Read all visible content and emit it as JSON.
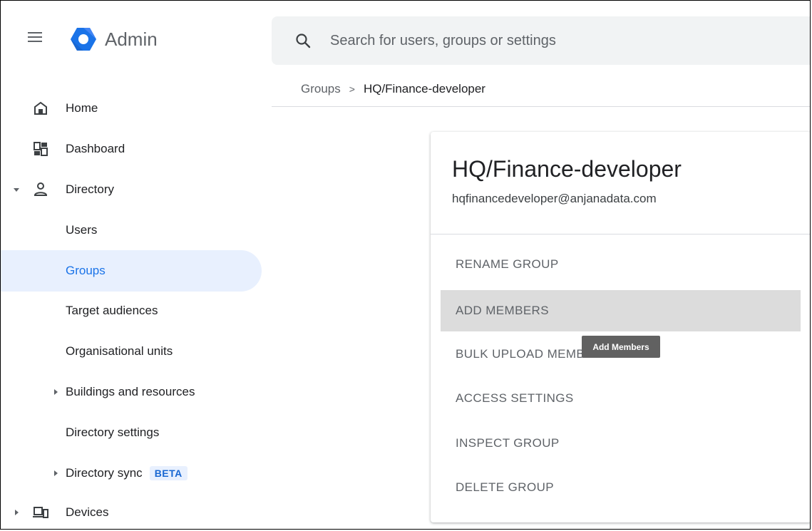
{
  "header": {
    "brand": "Admin",
    "search_placeholder": "Search for users, groups or settings"
  },
  "breadcrumb": {
    "parent": "Groups",
    "separator": ">",
    "current": "HQ/Finance-developer"
  },
  "sidebar": {
    "items": [
      {
        "label": "Home",
        "icon": "home-icon"
      },
      {
        "label": "Dashboard",
        "icon": "dashboard-icon"
      },
      {
        "label": "Directory",
        "icon": "person-icon",
        "expanded": true
      },
      {
        "label": "Users"
      },
      {
        "label": "Groups",
        "active": true
      },
      {
        "label": "Target audiences"
      },
      {
        "label": "Organisational units"
      },
      {
        "label": "Buildings and resources",
        "collapsed": true
      },
      {
        "label": "Directory settings"
      },
      {
        "label": "Directory sync",
        "collapsed": true,
        "badge": "BETA"
      },
      {
        "label": "Devices",
        "icon": "devices-icon",
        "collapsed": true
      }
    ]
  },
  "group": {
    "title": "HQ/Finance-developer",
    "email": "hqfinancedeveloper@anjanadata.com"
  },
  "actions": [
    {
      "label": "RENAME GROUP"
    },
    {
      "label": "ADD MEMBERS",
      "hovered": true
    },
    {
      "label": "BULK UPLOAD MEMBERS"
    },
    {
      "label": "ACCESS SETTINGS"
    },
    {
      "label": "INSPECT GROUP"
    },
    {
      "label": "DELETE GROUP"
    }
  ],
  "tooltip": "Add Members",
  "colors": {
    "accent": "#1a73e8",
    "active_bg": "#e8f0fe",
    "hover_bg": "#dcdcdc",
    "tooltip_bg": "#616161"
  }
}
